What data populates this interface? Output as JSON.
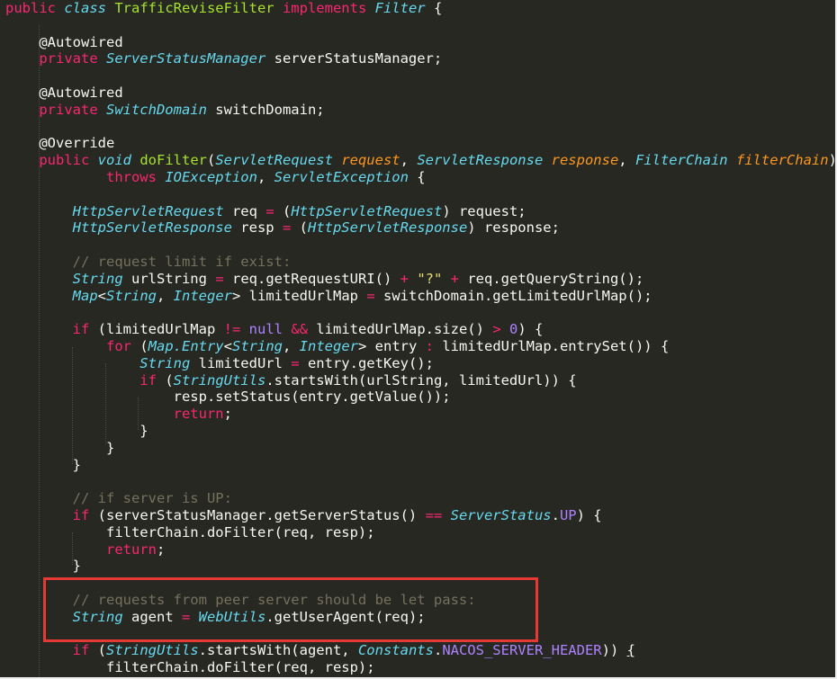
{
  "editor": {
    "theme": "dark monokai-like",
    "colors": {
      "background": "#272822",
      "keyword": "#f92672",
      "type": "#66d9ef",
      "method": "#a6e22e",
      "param": "#fd971f",
      "string": "#e6db74",
      "number": "#ae81ff",
      "comment": "#75715e",
      "highlight_box": "#e53935"
    },
    "lines": [
      [
        {
          "c": "k",
          "t": "public "
        },
        {
          "c": "t",
          "t": "class "
        },
        {
          "c": "f",
          "t": "TrafficReviseFilter "
        },
        {
          "c": "k",
          "t": "implements "
        },
        {
          "c": "t",
          "t": "Filter"
        },
        {
          "c": "w",
          "t": " {"
        }
      ],
      [],
      [
        {
          "c": "w",
          "t": "    @Autowired"
        }
      ],
      [
        {
          "c": "k",
          "t": "    private "
        },
        {
          "c": "t",
          "t": "ServerStatusManager"
        },
        {
          "c": "w",
          "t": " serverStatusManager;"
        }
      ],
      [],
      [
        {
          "c": "w",
          "t": "    @Autowired"
        }
      ],
      [
        {
          "c": "k",
          "t": "    private "
        },
        {
          "c": "t",
          "t": "SwitchDomain"
        },
        {
          "c": "w",
          "t": " switchDomain;"
        }
      ],
      [],
      [
        {
          "c": "w",
          "t": "    @Override"
        }
      ],
      [
        {
          "c": "k",
          "t": "    public "
        },
        {
          "c": "t",
          "t": "void "
        },
        {
          "c": "f",
          "t": "doFilter"
        },
        {
          "c": "w",
          "t": "("
        },
        {
          "c": "t",
          "t": "ServletRequest "
        },
        {
          "c": "p",
          "t": "request"
        },
        {
          "c": "w",
          "t": ", "
        },
        {
          "c": "t",
          "t": "ServletResponse "
        },
        {
          "c": "p",
          "t": "response"
        },
        {
          "c": "w",
          "t": ", "
        },
        {
          "c": "t",
          "t": "FilterChain "
        },
        {
          "c": "p",
          "t": "filterChain"
        },
        {
          "c": "w",
          "t": ")"
        }
      ],
      [
        {
          "c": "k",
          "t": "            throws "
        },
        {
          "c": "t",
          "t": "IOException"
        },
        {
          "c": "w",
          "t": ", "
        },
        {
          "c": "t",
          "t": "ServletException"
        },
        {
          "c": "w",
          "t": " {"
        }
      ],
      [],
      [
        {
          "c": "t",
          "t": "        HttpServletRequest"
        },
        {
          "c": "w",
          "t": " req "
        },
        {
          "c": "o",
          "t": "="
        },
        {
          "c": "w",
          "t": " ("
        },
        {
          "c": "t",
          "t": "HttpServletRequest"
        },
        {
          "c": "w",
          "t": ") request;"
        }
      ],
      [
        {
          "c": "t",
          "t": "        HttpServletResponse"
        },
        {
          "c": "w",
          "t": " resp "
        },
        {
          "c": "o",
          "t": "="
        },
        {
          "c": "w",
          "t": " ("
        },
        {
          "c": "t",
          "t": "HttpServletResponse"
        },
        {
          "c": "w",
          "t": ") response;"
        }
      ],
      [],
      [
        {
          "c": "c",
          "t": "        // request limit if exist:"
        }
      ],
      [
        {
          "c": "t",
          "t": "        String"
        },
        {
          "c": "w",
          "t": " urlString "
        },
        {
          "c": "o",
          "t": "="
        },
        {
          "c": "w",
          "t": " req.getRequestURI() "
        },
        {
          "c": "o",
          "t": "+"
        },
        {
          "c": "w",
          "t": " "
        },
        {
          "c": "s",
          "t": "\"?\""
        },
        {
          "c": "w",
          "t": " "
        },
        {
          "c": "o",
          "t": "+"
        },
        {
          "c": "w",
          "t": " req.getQueryString();"
        }
      ],
      [
        {
          "c": "t",
          "t": "        Map"
        },
        {
          "c": "w",
          "t": "<"
        },
        {
          "c": "t",
          "t": "String"
        },
        {
          "c": "w",
          "t": ", "
        },
        {
          "c": "t",
          "t": "Integer"
        },
        {
          "c": "w",
          "t": "> limitedUrlMap "
        },
        {
          "c": "o",
          "t": "="
        },
        {
          "c": "w",
          "t": " switchDomain.getLimitedUrlMap();"
        }
      ],
      [],
      [
        {
          "c": "k",
          "t": "        if"
        },
        {
          "c": "w",
          "t": " (limitedUrlMap "
        },
        {
          "c": "o",
          "t": "!="
        },
        {
          "c": "w",
          "t": " "
        },
        {
          "c": "n",
          "t": "null"
        },
        {
          "c": "w",
          "t": " "
        },
        {
          "c": "o",
          "t": "&&"
        },
        {
          "c": "w",
          "t": " limitedUrlMap.size() "
        },
        {
          "c": "o",
          "t": ">"
        },
        {
          "c": "w",
          "t": " "
        },
        {
          "c": "n",
          "t": "0"
        },
        {
          "c": "w",
          "t": ") {"
        }
      ],
      [
        {
          "c": "k",
          "t": "            for"
        },
        {
          "c": "w",
          "t": " ("
        },
        {
          "c": "t",
          "t": "Map.Entry"
        },
        {
          "c": "w",
          "t": "<"
        },
        {
          "c": "t",
          "t": "String"
        },
        {
          "c": "w",
          "t": ", "
        },
        {
          "c": "t",
          "t": "Integer"
        },
        {
          "c": "w",
          "t": "> entry "
        },
        {
          "c": "o",
          "t": ":"
        },
        {
          "c": "w",
          "t": " limitedUrlMap.entrySet()) {"
        }
      ],
      [
        {
          "c": "t",
          "t": "                String"
        },
        {
          "c": "w",
          "t": " limitedUrl "
        },
        {
          "c": "o",
          "t": "="
        },
        {
          "c": "w",
          "t": " entry.getKey();"
        }
      ],
      [
        {
          "c": "k",
          "t": "                if"
        },
        {
          "c": "w",
          "t": " ("
        },
        {
          "c": "t",
          "t": "StringUtils"
        },
        {
          "c": "w",
          "t": ".startsWith(urlString, limitedUrl)) {"
        }
      ],
      [
        {
          "c": "w",
          "t": "                    resp.setStatus(entry.getValue());"
        }
      ],
      [
        {
          "c": "k",
          "t": "                    return"
        },
        {
          "c": "w",
          "t": ";"
        }
      ],
      [
        {
          "c": "w",
          "t": "                }"
        }
      ],
      [
        {
          "c": "w",
          "t": "            }"
        }
      ],
      [
        {
          "c": "w",
          "t": "        }"
        }
      ],
      [],
      [
        {
          "c": "c",
          "t": "        // if server is UP:"
        }
      ],
      [
        {
          "c": "k",
          "t": "        if"
        },
        {
          "c": "w",
          "t": " (serverStatusManager.getServerStatus() "
        },
        {
          "c": "o",
          "t": "=="
        },
        {
          "c": "w",
          "t": " "
        },
        {
          "c": "t",
          "t": "ServerStatus"
        },
        {
          "c": "w",
          "t": "."
        },
        {
          "c": "n",
          "t": "UP"
        },
        {
          "c": "w",
          "t": ") {"
        }
      ],
      [
        {
          "c": "w",
          "t": "            filterChain.doFilter(req, resp);"
        }
      ],
      [
        {
          "c": "k",
          "t": "            return"
        },
        {
          "c": "w",
          "t": ";"
        }
      ],
      [
        {
          "c": "w",
          "t": "        }"
        }
      ],
      [],
      [
        {
          "c": "c",
          "t": "        // requests from peer server should be let pass:"
        }
      ],
      [
        {
          "c": "t",
          "t": "        String"
        },
        {
          "c": "w",
          "t": " agent "
        },
        {
          "c": "o",
          "t": "="
        },
        {
          "c": "w",
          "t": " "
        },
        {
          "c": "t",
          "t": "WebUtils"
        },
        {
          "c": "w",
          "t": ".getUserAgent(req);"
        }
      ],
      [],
      [
        {
          "c": "k",
          "t": "        if"
        },
        {
          "c": "w",
          "t": " ("
        },
        {
          "c": "t",
          "t": "StringUtils"
        },
        {
          "c": "w",
          "t": ".startsWith(agent, "
        },
        {
          "c": "t",
          "t": "Constants"
        },
        {
          "c": "w",
          "t": "."
        },
        {
          "c": "n",
          "t": "NACOS_SERVER_HEADER"
        },
        {
          "c": "w",
          "t": ")) "
        },
        {
          "c": "ul",
          "t": "{"
        }
      ],
      [
        {
          "c": "w",
          "t": "            filterChain.doFilter(req, resp);"
        }
      ]
    ]
  }
}
